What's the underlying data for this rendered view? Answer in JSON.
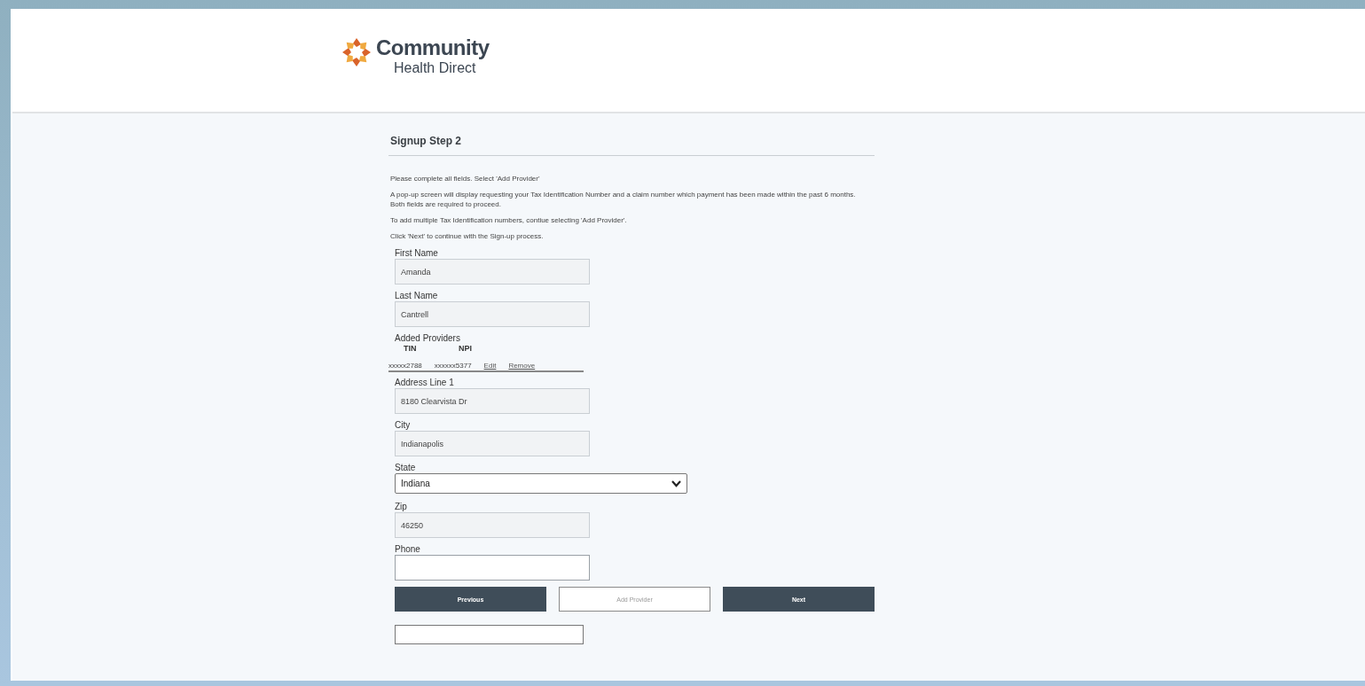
{
  "header": {
    "logo_line_1": "Community",
    "logo_line_2": "Health Direct"
  },
  "title": "Signup Step 2",
  "instructions": [
    "Please complete all fields. Select 'Add Provider'",
    "A pop-up screen will display requesting your Tax Identification Number and a claim number which payment has been made within the past 6 months. Both fields are required to proceed.",
    "To add multiple Tax Identification numbers, contiue selecting 'Add Provider'.",
    "Click 'Next' to continue with the Sign-up process."
  ],
  "fields_top": [
    {
      "label": "First Name",
      "value": "Amanda",
      "disabled": true
    },
    {
      "label": "Last Name",
      "value": "Cantrell",
      "disabled": true
    }
  ],
  "added_providers": {
    "label": "Added Providers",
    "columns": [
      "TIN",
      "NPI"
    ],
    "rows": [
      {
        "tin": "xxxxx2788",
        "npi": "xxxxxx5377",
        "edit": "Edit",
        "remove": "Remove"
      }
    ]
  },
  "fields_bottom": [
    {
      "kind": "text",
      "label": "Address Line 1",
      "value": "8180 Clearvista Dr",
      "disabled": true
    },
    {
      "kind": "text",
      "label": "City",
      "value": "Indianapolis",
      "disabled": true
    },
    {
      "kind": "select",
      "label": "State",
      "value": "Indiana",
      "disabled": false
    },
    {
      "kind": "text",
      "label": "Zip",
      "value": "46250",
      "disabled": true
    },
    {
      "kind": "text",
      "label": "Phone",
      "disabled": false
    }
  ],
  "buttons": [
    {
      "label": "Previous",
      "kind": "primary"
    },
    {
      "label": "Add Provider",
      "kind": "outline"
    },
    {
      "label": "Next",
      "kind": "primary"
    }
  ]
}
